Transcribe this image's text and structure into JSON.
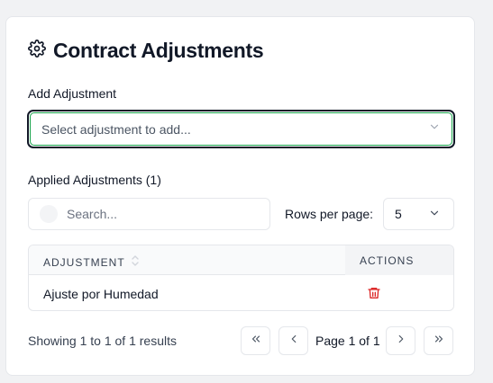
{
  "header": {
    "title": "Contract Adjustments",
    "icon": "gear-icon"
  },
  "add_adjustment": {
    "label": "Add Adjustment",
    "select_placeholder": "Select adjustment to add..."
  },
  "applied": {
    "label": "Applied Adjustments (1)",
    "search_placeholder": "Search...",
    "rows_per_page_label": "Rows per page:",
    "rows_per_page_value": "5"
  },
  "table": {
    "columns": [
      "ADJUSTMENT",
      "ACTIONS"
    ],
    "rows": [
      {
        "name": "Ajuste por Humedad",
        "action_icon": "trash-icon"
      }
    ]
  },
  "pagination": {
    "summary": "Showing 1 to 1 of 1 results",
    "page_text": "Page 1 of 1"
  },
  "colors": {
    "focus_green": "#16a34a",
    "danger_red": "#dc2626",
    "text": "#111827"
  }
}
